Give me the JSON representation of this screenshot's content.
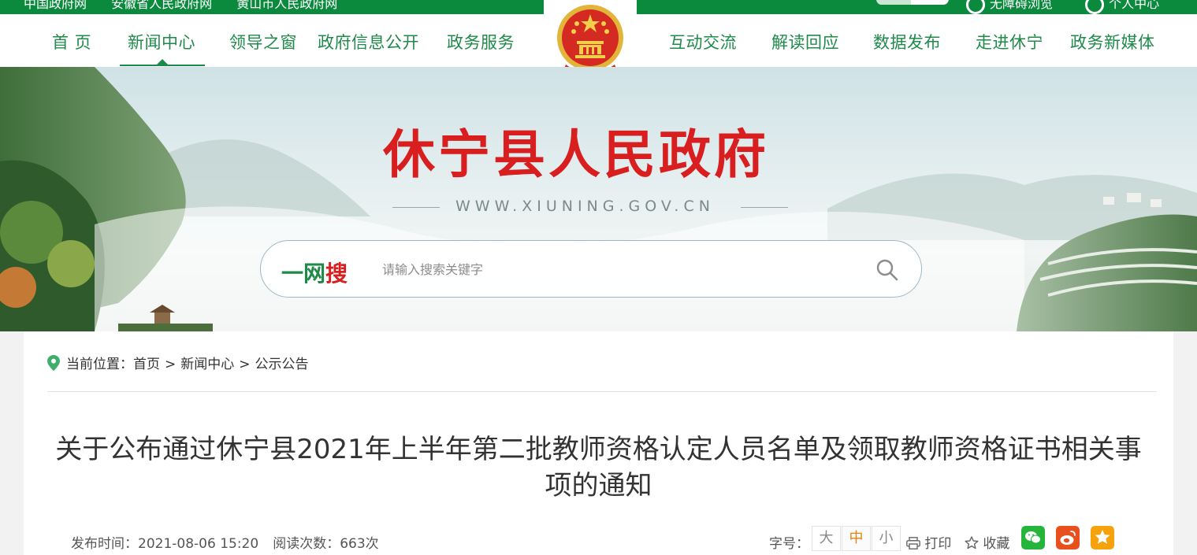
{
  "top_strip": {
    "links": [
      "中国政府网",
      "安徽省人民政府网",
      "黄山市人民政府网"
    ],
    "right_items": [
      "无障碍浏览",
      "个人中心"
    ]
  },
  "nav": {
    "items": [
      "首 页",
      "新闻中心",
      "领导之窗",
      "政府信息公开",
      "政务服务",
      "互动交流",
      "解读回应",
      "数据发布",
      "走进休宁",
      "政务新媒体"
    ],
    "active": "新闻中心"
  },
  "banner": {
    "title": "休宁县人民政府",
    "domain": "WWW.XIUNING.GOV.CN"
  },
  "search": {
    "brand_prefix": "一网",
    "brand_suffix": "搜",
    "placeholder": "请输入搜索关键字"
  },
  "breadcrumb": {
    "label": "当前位置：",
    "items": [
      "首页",
      "新闻中心",
      "公示公告"
    ],
    "separator": ">"
  },
  "article": {
    "title": "关于公布通过休宁县2021年上半年第二批教师资格认定人员名单及领取教师资格证书相关事项的通知",
    "publish_label": "发布时间：",
    "publish_time": "2021-08-06 15:20",
    "views_label": "阅读次数：",
    "views": "663次"
  },
  "tools": {
    "font_size_label": "字号：",
    "font_sizes": [
      "大",
      "中",
      "小"
    ],
    "active_font_size": "中",
    "print_label": "打印",
    "favorite_label": "收藏"
  },
  "colors": {
    "brand_green": "#0b8a3e",
    "nav_text": "#1f8a4a",
    "title_red": "#d81e1e",
    "wechat": "#25b53a",
    "weibo": "#e8501e",
    "qzone": "#f5a20c"
  }
}
